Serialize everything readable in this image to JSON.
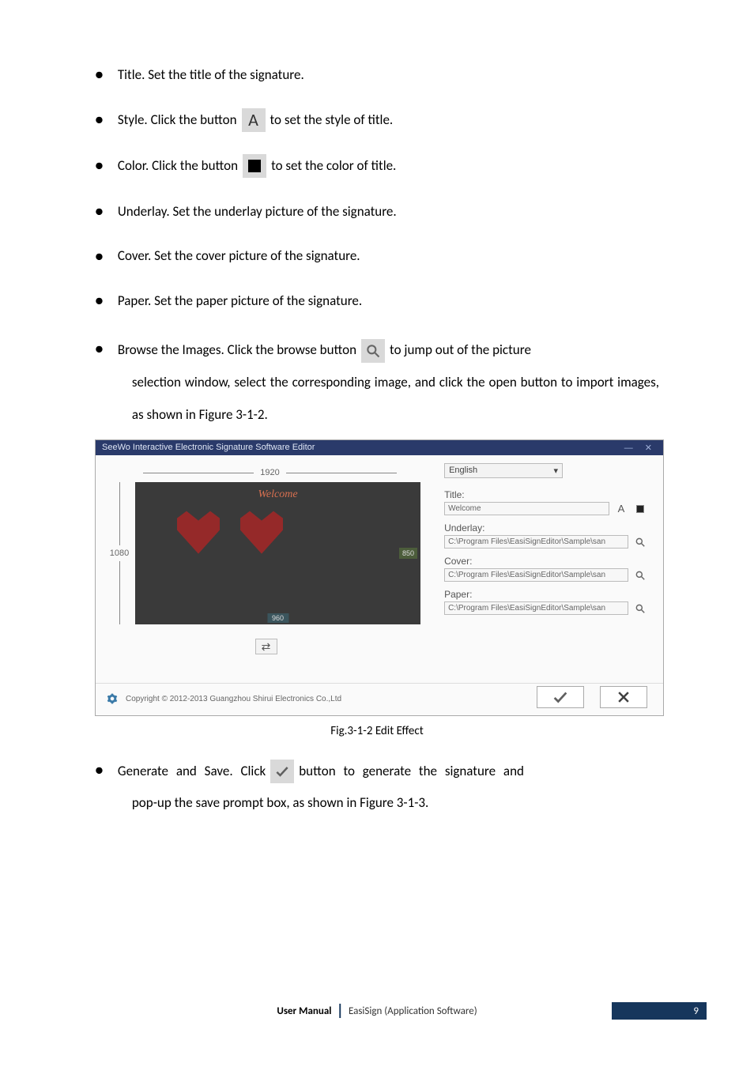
{
  "bullets": {
    "title": "Title. Set the title of the signature.",
    "style_pre": "Style. Click the button",
    "style_post": "to set the style of title.",
    "style_icon_glyph": "A",
    "color_pre": "Color. Click the button",
    "color_post": "to set the color of title.",
    "underlay": "Underlay. Set the underlay picture of the signature.",
    "cover": "Cover. Set the cover picture of the signature.",
    "paper": "Paper. Set the paper picture of the signature.",
    "browse_pre": "Browse the Images. Click the browse button",
    "browse_post": "to jump out of the picture",
    "browse_line2": "selection window, select the corresponding image, and click the open button to import images, as shown in Figure 3-1-2.",
    "generate_pre": "Generate and Save. Click",
    "generate_post": "button to generate the signature and",
    "generate_line2": "pop-up the save prompt box, as shown in Figure 3-1-3."
  },
  "editor": {
    "window_title": "SeeWo Interactive Electronic Signature Software Editor",
    "dim_w": "1920",
    "dim_h": "1080",
    "preview_title": "Welcome",
    "badge_right": "850",
    "badge_bottom": "960",
    "language": "English",
    "fields": {
      "title_label": "Title:",
      "title_value": "Welcome",
      "title_style_glyph": "A",
      "underlay_label": "Underlay:",
      "underlay_value": "C:\\Program Files\\EasiSignEditor\\Sample\\san",
      "cover_label": "Cover:",
      "cover_value": "C:\\Program Files\\EasiSignEditor\\Sample\\san",
      "paper_label": "Paper:",
      "paper_value": "C:\\Program Files\\EasiSignEditor\\Sample\\san"
    },
    "copyright": "Copyright © 2012-2013 Guangzhou Shirui Electronics Co.,Ltd"
  },
  "fig_caption": "Fig.3-1-2 Edit Effect",
  "footer": {
    "user_manual": "User Manual",
    "app_name": "EasiSign (Application Software)",
    "page_number": "9"
  }
}
